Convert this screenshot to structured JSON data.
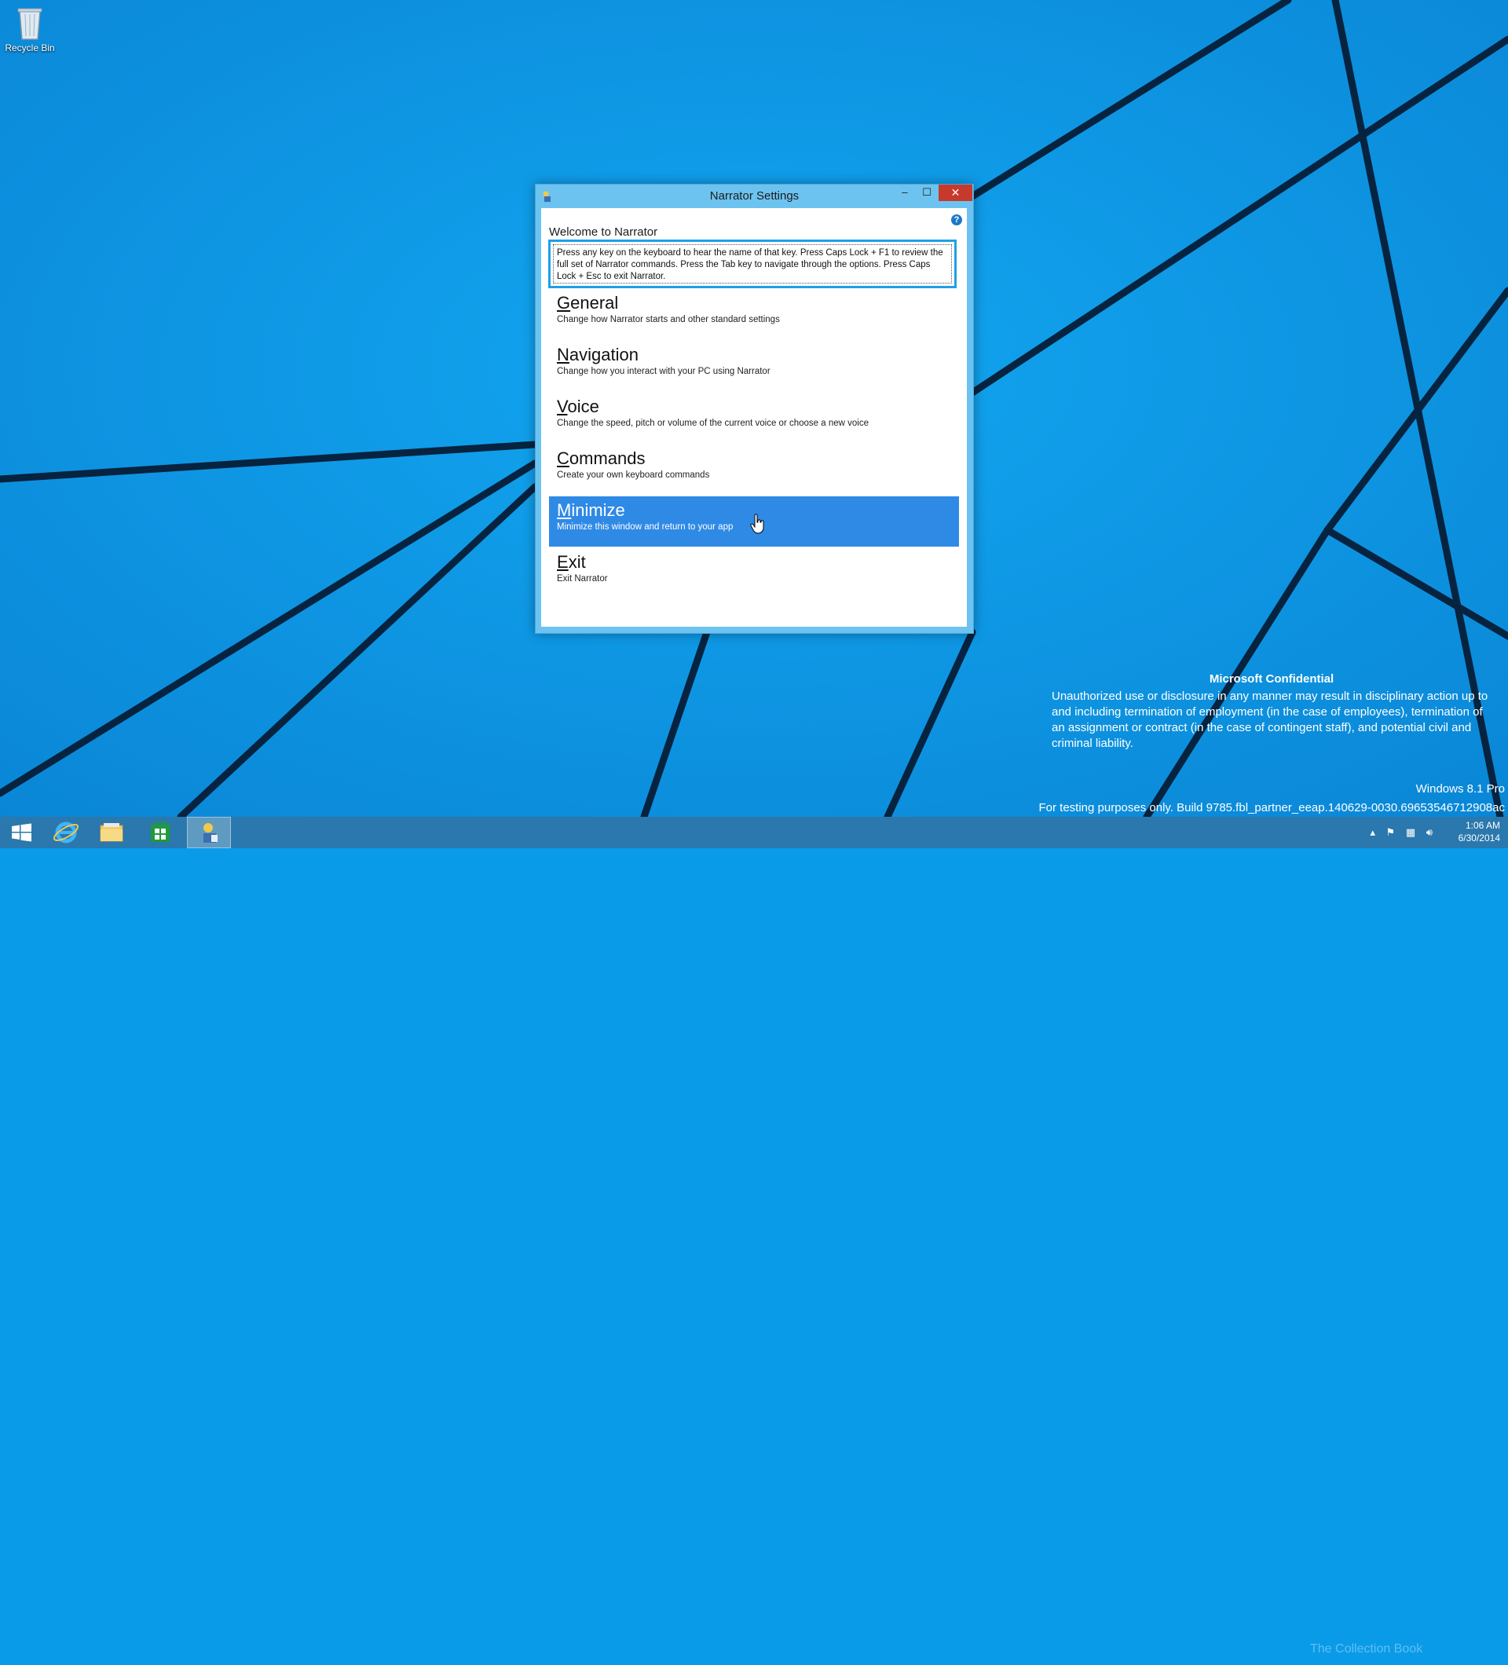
{
  "desktop": {
    "recycle_bin_label": "Recycle Bin"
  },
  "window": {
    "title": "Narrator Settings",
    "minimize_glyph": "–",
    "maximize_glyph": "☐",
    "close_glyph": "✕",
    "help_glyph": "?",
    "welcome_heading": "Welcome to Narrator",
    "info_text": "Press any key on the keyboard to hear the name of that key.  Press Caps Lock + F1 to review the full set of Narrator commands.  Press the Tab key to navigate through the options.  Press Caps Lock + Esc to exit Narrator.",
    "menu": [
      {
        "key": "G",
        "rest": "eneral",
        "desc": "Change how Narrator starts and other standard settings",
        "selected": false
      },
      {
        "key": "N",
        "rest": "avigation",
        "desc": "Change how you interact with your PC using Narrator",
        "selected": false
      },
      {
        "key": "V",
        "rest": "oice",
        "desc": "Change the speed, pitch or volume of the current voice or choose a new voice",
        "selected": false
      },
      {
        "key": "C",
        "rest": "ommands",
        "desc": "Create your own keyboard commands",
        "selected": false
      },
      {
        "key": "M",
        "rest": "inimize",
        "desc": "Minimize this window and return to your app",
        "selected": true
      },
      {
        "key": "E",
        "rest": "xit",
        "desc": "Exit Narrator",
        "selected": false
      }
    ]
  },
  "watermark": {
    "title": "Microsoft Confidential",
    "body": "Unauthorized use or disclosure in any manner may result in disciplinary action up to and including termination of employment (in the case of employees), termination of an assignment or contract (in the case of contingent staff), and potential civil and criminal liability.",
    "edition": "Windows 8.1 Pro",
    "build": "For testing purposes only. Build 9785.fbl_partner_eeap.140629-0030.69653546712908ac",
    "collection": "The Collection Book"
  },
  "taskbar": {
    "items": [
      "start",
      "internet-explorer",
      "file-explorer",
      "store",
      "narrator"
    ],
    "time": "1:06 AM",
    "date": "6/30/2014"
  },
  "colors": {
    "desktop_bg": "#0a9be8",
    "title_bar": "#6cc3f0",
    "close_button": "#c7392b",
    "selected_item": "#2f8ae6",
    "focus_border": "#1ea0e6"
  }
}
